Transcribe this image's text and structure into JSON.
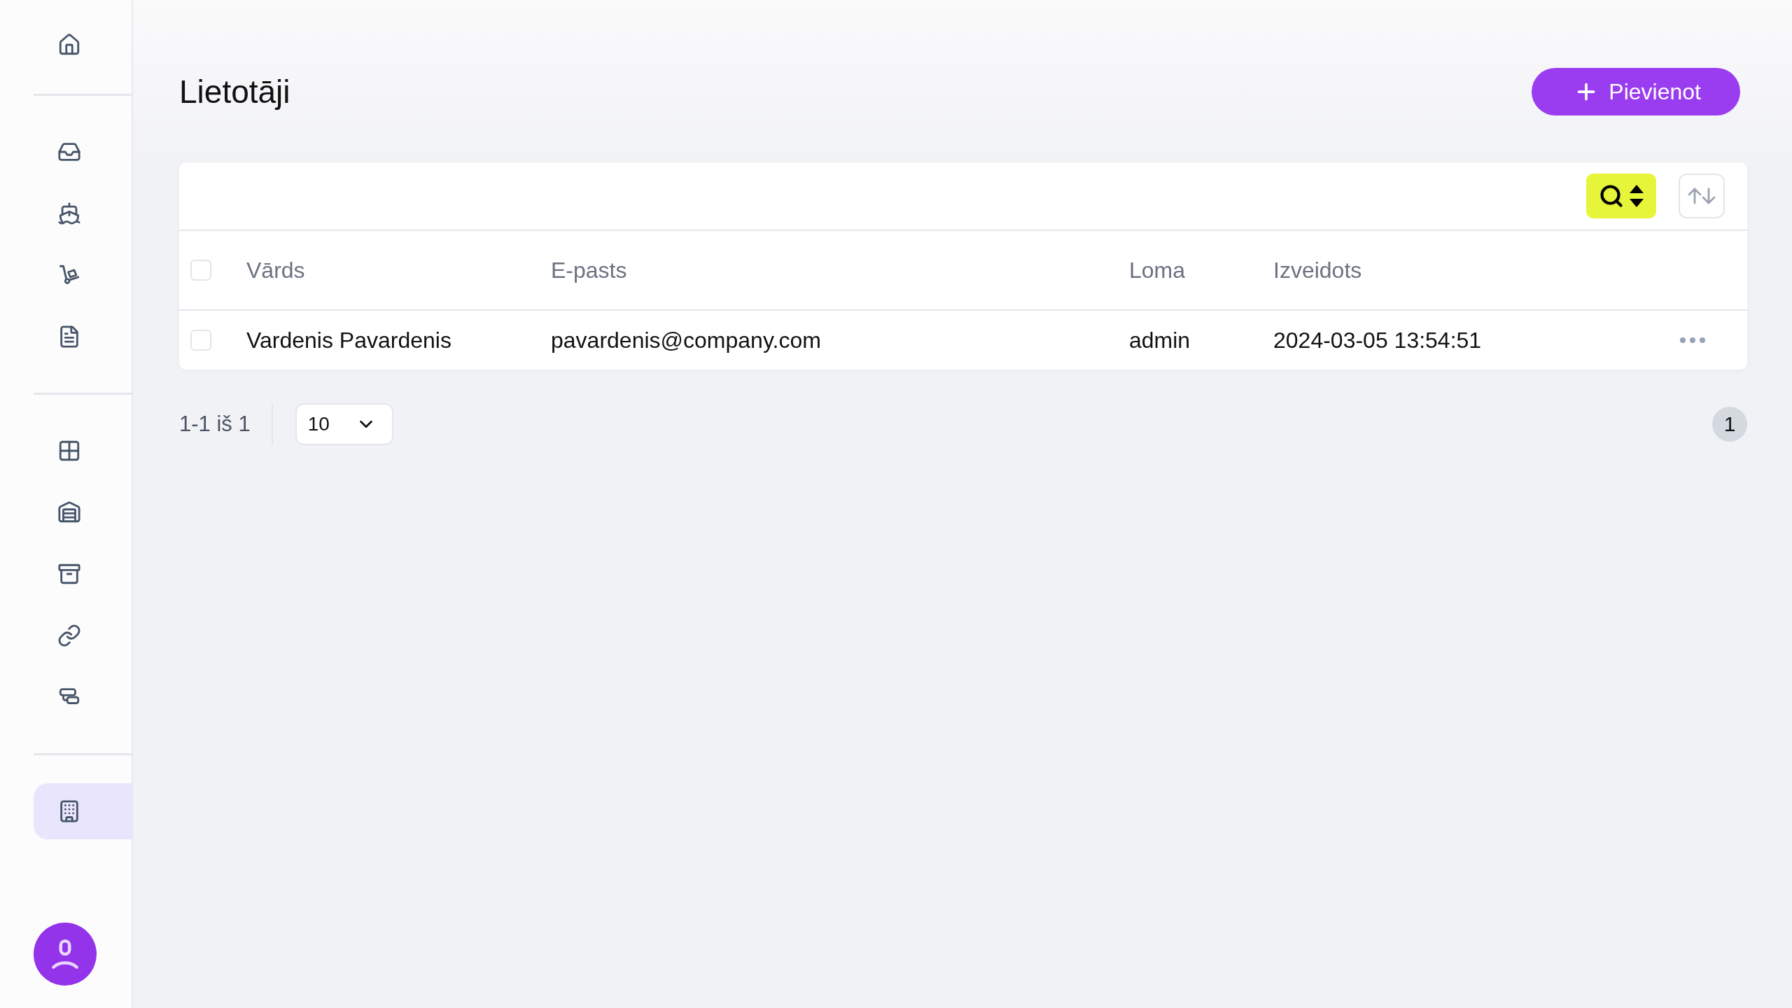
{
  "sidebar": {
    "groups": [
      {
        "items": [
          {
            "selected": false
          }
        ]
      },
      {
        "items": [
          {
            "selected": false
          },
          {
            "selected": false
          },
          {
            "selected": false
          },
          {
            "selected": false
          }
        ]
      },
      {
        "items": [
          {
            "selected": false
          },
          {
            "selected": false
          },
          {
            "selected": false
          },
          {
            "selected": false
          },
          {
            "selected": false
          }
        ]
      },
      {
        "items": [
          {
            "selected": true
          }
        ]
      }
    ]
  },
  "page": {
    "title": "Lietotāji",
    "add_button": "Pievienot"
  },
  "table": {
    "columns": [
      "Vārds",
      "E-pasts",
      "Loma",
      "Izveidots"
    ],
    "rows": [
      {
        "selected": false,
        "cells": [
          "Vardenis Pavardenis",
          "pavardenis@company.com",
          "admin",
          "2024-03-05 13:54:51"
        ]
      }
    ],
    "all_selected": false
  },
  "pagination": {
    "range": "1-1 iš 1",
    "page_size": "10",
    "pages": [
      {
        "label": "1",
        "selected": true
      }
    ]
  }
}
